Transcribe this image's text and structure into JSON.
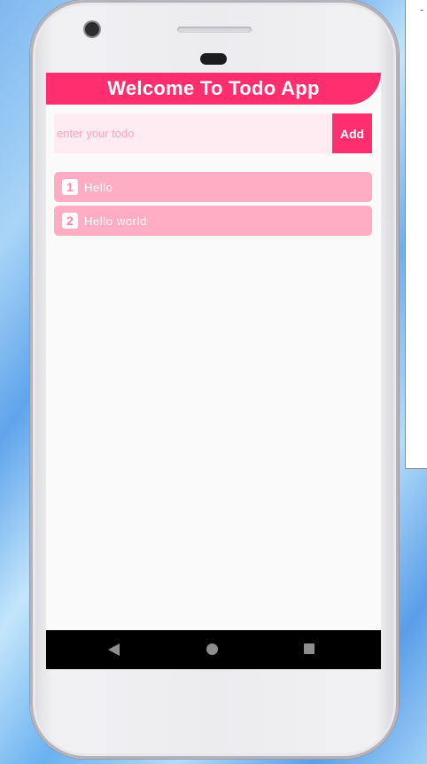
{
  "app": {
    "title": "Welcome To Todo App"
  },
  "input": {
    "placeholder": "enter your todo",
    "value": ""
  },
  "add_button": {
    "label": "Add"
  },
  "todos": [
    {
      "number": "1",
      "text": "Hello"
    },
    {
      "number": "2",
      "text": "Hello world"
    }
  ],
  "nav": {
    "back_icon": "back-triangle-icon",
    "home_icon": "home-circle-icon",
    "recent_icon": "recent-square-icon"
  },
  "colors": {
    "accent": "#ff2e6e",
    "input_bg": "#ffebf1",
    "item_bg": "#ffacc5",
    "screen_bg": "#fafafa"
  }
}
